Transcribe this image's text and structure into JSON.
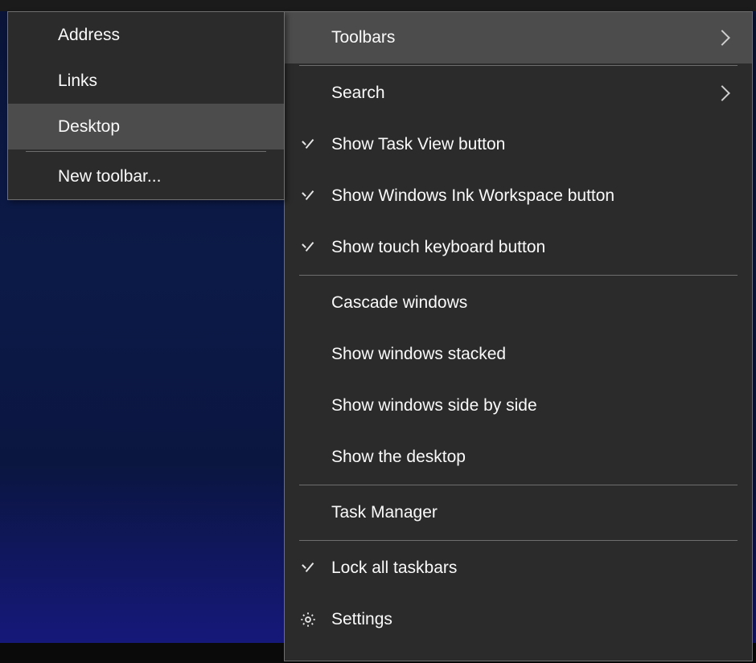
{
  "main": {
    "toolbars": "Toolbars",
    "search": "Search",
    "show_task_view": "Show Task View button",
    "show_ink": "Show Windows Ink Workspace button",
    "show_touch": "Show touch keyboard button",
    "cascade": "Cascade windows",
    "stacked": "Show windows stacked",
    "sidebyside": "Show windows side by side",
    "show_desktop": "Show the desktop",
    "task_manager": "Task Manager",
    "lock_all": "Lock all taskbars",
    "settings": "Settings"
  },
  "submenu": {
    "address": "Address",
    "links": "Links",
    "desktop": "Desktop",
    "new_toolbar": "New toolbar..."
  }
}
